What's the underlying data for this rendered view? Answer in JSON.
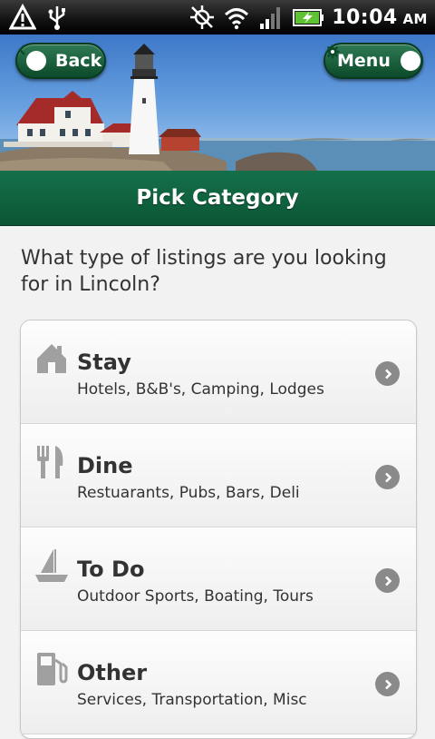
{
  "status_bar": {
    "time": "10:04",
    "ampm": "AM",
    "icons": [
      "warning-icon",
      "usb-icon",
      "gps-off-icon",
      "wifi-icon",
      "signal-icon",
      "battery-charging-icon"
    ]
  },
  "header": {
    "back_label": "Back",
    "menu_label": "Menu",
    "title": "Pick Category"
  },
  "prompt": "What type of listings are you looking for in Lincoln?",
  "categories": [
    {
      "title": "Stay",
      "subtitle": "Hotels, B&B's, Camping, Lodges",
      "icon": "house-icon"
    },
    {
      "title": "Dine",
      "subtitle": "Restuarants, Pubs, Bars, Deli",
      "icon": "fork-knife-icon"
    },
    {
      "title": "To Do",
      "subtitle": "Outdoor Sports, Boating, Tours",
      "icon": "sailboat-icon"
    },
    {
      "title": "Other",
      "subtitle": "Services, Transportation, Misc",
      "icon": "gas-pump-icon"
    }
  ],
  "colors": {
    "header_green": "#0b5634",
    "icon_gray": "#a0a0a0",
    "arrow_gray": "#8a8a8a"
  }
}
